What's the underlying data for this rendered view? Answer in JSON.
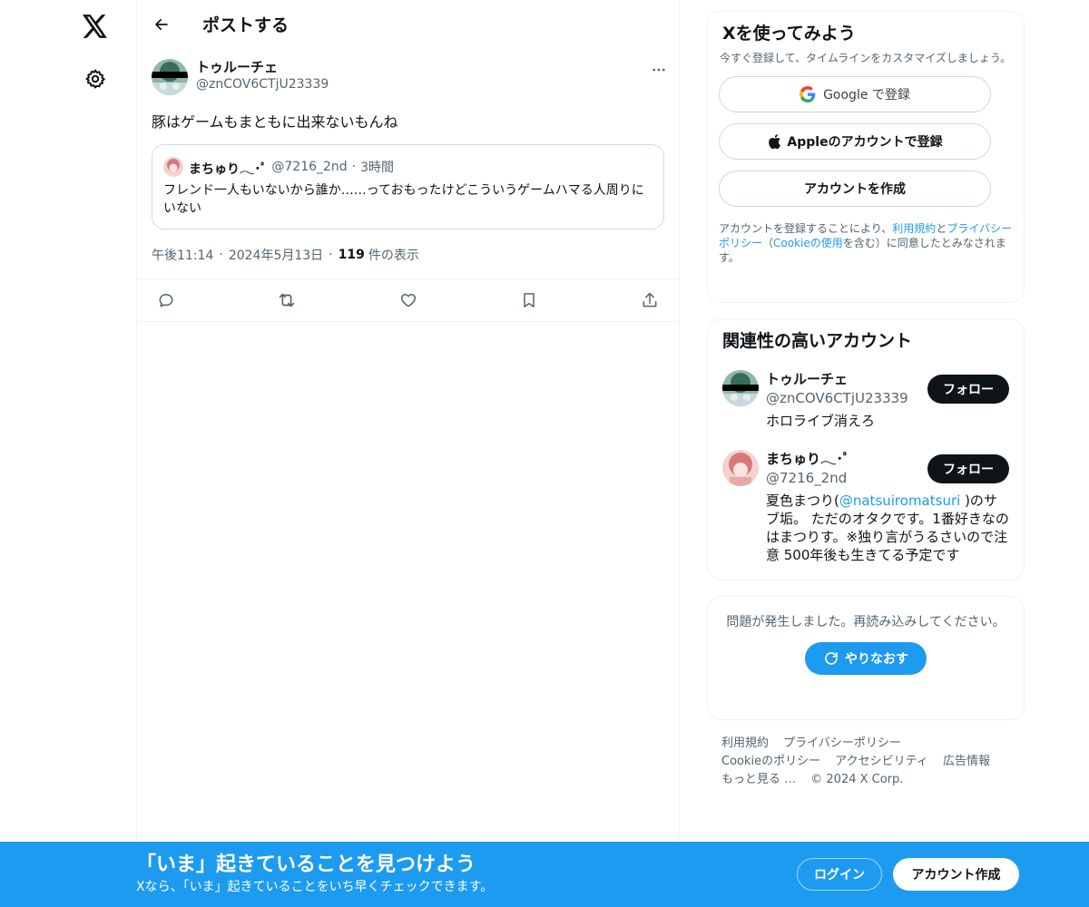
{
  "header": {
    "title": "ポストする"
  },
  "post": {
    "author_name": "トゥルーチェ",
    "author_handle": "@znCOV6CTjU23339",
    "text": "豚はゲームもまともに出来ないもんね",
    "quote": {
      "name": "まちゅり𓂃･ﾟ",
      "handle": "@7216_2nd",
      "separator": "·",
      "time": "3時間",
      "text": "フレンド一人もいないから誰か……っておもったけどこういうゲームハマる人周りにいない"
    },
    "meta": {
      "time": "午後11:14",
      "sep1": "·",
      "date": "2024年5月13日",
      "sep2": "·",
      "views_count": "119",
      "views_label": "件の表示"
    },
    "actions": [
      "reply",
      "repost",
      "like",
      "bookmark",
      "share"
    ]
  },
  "signup": {
    "title": "Xを使ってみよう",
    "subtitle": "今すぐ登録して、タイムラインをカスタマイズしましょう。",
    "google_label": "Google で登録",
    "apple_label": "Appleのアカウントで登録",
    "create_label": "アカウントを作成",
    "terms_prefix": "アカウントを登録することにより、",
    "terms_link1": "利用規約",
    "terms_and": "と",
    "terms_link2": "プライバシーポリシー",
    "terms_paren_open": "（",
    "terms_link3": "Cookieの使用",
    "terms_paren_rest": "を含む）に同意したとみなされます。"
  },
  "related": {
    "title": "関連性の高いアカウント",
    "follow_label": "フォロー",
    "accounts": [
      {
        "name": "トゥルーチェ",
        "handle": "@znCOV6CTjU23339",
        "bio": "ホロライブ消えろ"
      },
      {
        "name": "まちゅり𓂃･ﾟ",
        "handle": "@7216_2nd",
        "bio_pre": "夏色まつり(",
        "bio_link": "@natsuiromatsuri",
        "bio_post": " )のサブ垢。 ただのオタクです。1番好きなのはまつりす。※独り言がうるさいので注意 500年後も生きてる予定です"
      }
    ]
  },
  "error": {
    "text": "問題が発生しました。再読み込みしてください。",
    "retry_label": "やりなおす"
  },
  "footer": {
    "links": [
      "利用規約",
      "プライバシーポリシー",
      "Cookieのポリシー",
      "アクセシビリティ",
      "広告情報",
      "もっと見る …"
    ],
    "copyright": "© 2024 X Corp."
  },
  "bottom_bar": {
    "title": "「いま」起きていることを見つけよう",
    "subtitle": "Xなら、「いま」起きていることをいち早くチェックできます。",
    "login_label": "ログイン",
    "create_label": "アカウント作成"
  },
  "colors": {
    "accent": "#1d9bf0",
    "text_primary": "#0f1419",
    "text_secondary": "#536471",
    "border": "#eff3f4"
  }
}
